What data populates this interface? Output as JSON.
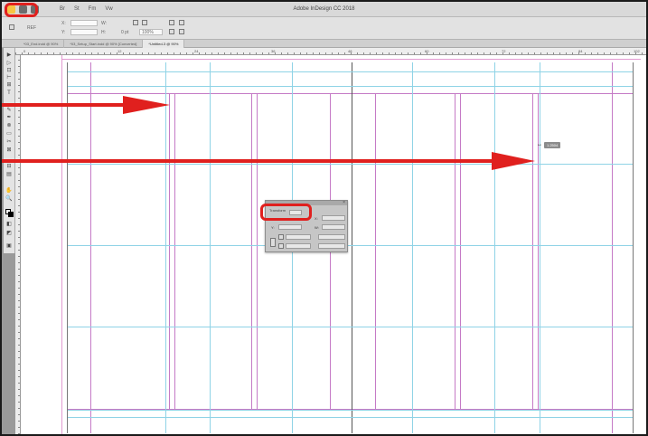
{
  "window": {
    "title": "Adobe InDesign CC 2018",
    "traffic_lights": [
      "#f7c443",
      "#6d6d6d",
      "#6d6d6d"
    ],
    "menu_icons": [
      "Br",
      "St",
      "Fm",
      "Vw"
    ]
  },
  "control_panel": {
    "x_label": "X:",
    "y_label": "Y:",
    "w_label": "W:",
    "h_label": "H:",
    "stroke_label": "0 pt",
    "zoom_value": "100%",
    "ref_label": "REF"
  },
  "tabs": [
    {
      "label": "*03_End.indd @ 90%",
      "active": false
    },
    {
      "label": "*03_Setup_Start.indd @ 90% [Converted]",
      "active": false
    },
    {
      "label": "*Untitled-3 @ 90%",
      "active": true
    }
  ],
  "ruler": {
    "marks": [
      "0",
      "6",
      "12",
      "18",
      "24",
      "30",
      "36",
      "42",
      "48",
      "54",
      "60",
      "66",
      "72",
      "78",
      "84",
      "90",
      "96",
      "102"
    ]
  },
  "tools": [
    "▶",
    "▷",
    "⊡",
    "⊢",
    "⊞",
    "T",
    "✎",
    "✒",
    "⊗",
    "▭",
    "✂",
    "⊠",
    "⊟",
    "▤",
    "✋",
    "🔍",
    "◧",
    "◩",
    "▣"
  ],
  "readout": {
    "value": "1.2504"
  },
  "floating_panel": {
    "tab": "Transform",
    "x_label": "X:",
    "w_label": "W:",
    "y_label": "Y:",
    "h_label": "H:"
  },
  "colors": {
    "highlight": "#e0201e",
    "margin_guide": "#b25ab4",
    "column_guide": "#6bc7e0",
    "arrow": "#e0201e"
  }
}
